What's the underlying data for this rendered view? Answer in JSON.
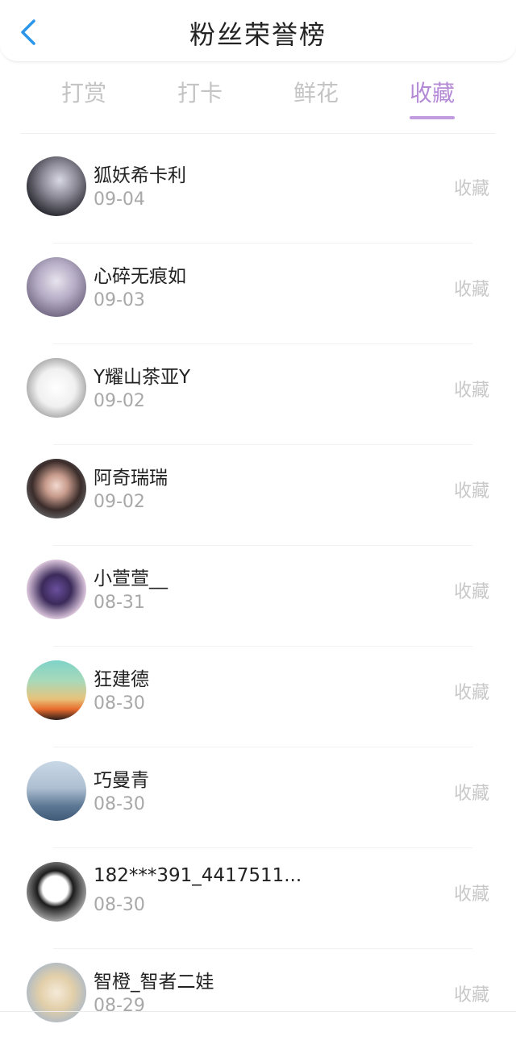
{
  "header": {
    "title": "粉丝荣誉榜",
    "back_icon": "chevron-left-icon"
  },
  "tabs": [
    {
      "label": "打赏",
      "active": false
    },
    {
      "label": "打卡",
      "active": false
    },
    {
      "label": "鲜花",
      "active": false
    },
    {
      "label": "收藏",
      "active": true
    }
  ],
  "colors": {
    "accent": "#b48ad6",
    "back": "#2b95e9"
  },
  "list": [
    {
      "name": "狐妖希卡利",
      "date": "09-04",
      "action": "收藏"
    },
    {
      "name": "心碎无痕如",
      "date": "09-03",
      "action": "收藏"
    },
    {
      "name": "Y耀山茶亚Y",
      "date": "09-02",
      "action": "收藏"
    },
    {
      "name": "阿奇瑞瑞",
      "date": "09-02",
      "action": "收藏"
    },
    {
      "name": "小萱萱__",
      "date": "08-31",
      "action": "收藏"
    },
    {
      "name": "狂建德",
      "date": "08-30",
      "action": "收藏"
    },
    {
      "name": "巧曼青",
      "date": "08-30",
      "action": "收藏"
    },
    {
      "name": "182***391_4417511...",
      "date": "08-30",
      "action": "收藏"
    },
    {
      "name": "智橙_智者二娃",
      "date": "08-29",
      "action": "收藏"
    }
  ]
}
